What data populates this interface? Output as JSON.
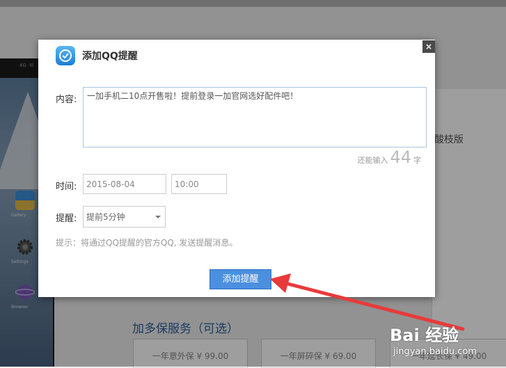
{
  "dialog": {
    "title": "添加QQ提醒",
    "close_label": "×",
    "content_label": "内容:",
    "content_value": "一加手机二10点开售啦！提前登录一加官网选好配件吧！",
    "remain_prefix": "还能输入",
    "remain_count": "44",
    "remain_suffix": "字",
    "time_label": "时间:",
    "date_value": "2015-08-04",
    "time_value": "10:00",
    "remind_label": "提醒:",
    "remind_selected": "提前5分钟",
    "hint": "提示：将通过QQ提醒的官方QQ, 发送提醒消息。",
    "add_button": "添加提醒"
  },
  "background": {
    "card_text": "酸枝版",
    "section_heading": "加多保服务（可选）",
    "options": [
      "一年意外保 ¥ 99.00",
      "一年屏碎保 ¥ 69.00",
      "一年延长保 ¥ 49.00"
    ],
    "phone_apps": [
      "Gallery",
      "Settings",
      "Browser"
    ],
    "phone_status": "4G ·lll"
  },
  "watermark": {
    "brand": "Bai 经验",
    "url": "jingyan.baidu.com"
  },
  "colors": {
    "primary_button": "#4a8fe0",
    "annotation_arrow": "#e83a3a",
    "heading_blue": "#2d5f9a"
  }
}
